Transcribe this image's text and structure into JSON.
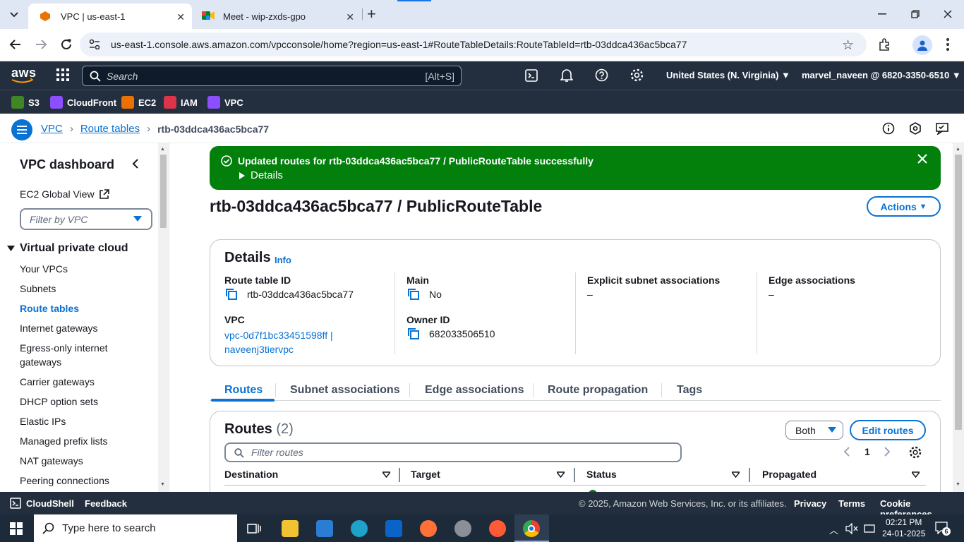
{
  "browser": {
    "tabs": [
      {
        "title": "VPC | us-east-1",
        "active": true
      },
      {
        "title": "Meet - wip-zxds-gpo",
        "active": false
      }
    ],
    "url": "us-east-1.console.aws.amazon.com/vpcconsole/home?region=us-east-1#RouteTableDetails:RouteTableId=rtb-03ddca436ac5bca77"
  },
  "aws_header": {
    "logo": "aws",
    "search_placeholder": "Search",
    "search_shortcut": "[Alt+S]",
    "region": "United States (N. Virginia)",
    "account": "marvel_naveen @ 6820-3350-6510",
    "favorites": [
      {
        "label": "S3",
        "color": "#3f8624"
      },
      {
        "label": "CloudFront",
        "color": "#8c4fff"
      },
      {
        "label": "EC2",
        "color": "#ed7100"
      },
      {
        "label": "IAM",
        "color": "#dd344c"
      },
      {
        "label": "VPC",
        "color": "#8c4fff"
      }
    ]
  },
  "breadcrumb": {
    "items": [
      "VPC",
      "Route tables"
    ],
    "current": "rtb-03ddca436ac5bca77"
  },
  "sidebar": {
    "title": "VPC dashboard",
    "ec2_global_view": "EC2 Global View",
    "filter_placeholder": "Filter by VPC",
    "section": "Virtual private cloud",
    "items": [
      {
        "label": "Your VPCs"
      },
      {
        "label": "Subnets"
      },
      {
        "label": "Route tables",
        "active": true
      },
      {
        "label": "Internet gateways"
      },
      {
        "label": "Egress-only internet gateways"
      },
      {
        "label": "Carrier gateways"
      },
      {
        "label": "DHCP option sets"
      },
      {
        "label": "Elastic IPs"
      },
      {
        "label": "Managed prefix lists"
      },
      {
        "label": "NAT gateways"
      },
      {
        "label": "Peering connections"
      }
    ]
  },
  "flash": {
    "message": "Updated routes for rtb-03ddca436ac5bca77 / PublicRouteTable successfully",
    "details": "Details",
    "color": "#037f0c"
  },
  "page": {
    "title": "rtb-03ddca436ac5bca77 / PublicRouteTable",
    "actions": "Actions"
  },
  "details": {
    "heading": "Details",
    "info": "Info",
    "route_table_id_label": "Route table ID",
    "route_table_id": "rtb-03ddca436ac5bca77",
    "vpc_label": "VPC",
    "vpc_link_1": "vpc-0d7f1bc33451598ff |",
    "vpc_link_2": "naveenj3tiervpc",
    "main_label": "Main",
    "main_value": "No",
    "owner_label": "Owner ID",
    "owner_value": "682033506510",
    "explicit_label": "Explicit subnet associations",
    "explicit_value": "–",
    "edge_label": "Edge associations",
    "edge_value": "–"
  },
  "tabs": [
    "Routes",
    "Subnet associations",
    "Edge associations",
    "Route propagation",
    "Tags"
  ],
  "routes": {
    "heading": "Routes",
    "count": "(2)",
    "filter_select": "Both",
    "edit_button": "Edit routes",
    "filter_placeholder": "Filter routes",
    "page": "1",
    "columns": [
      "Destination",
      "Target",
      "Status",
      "Propagated"
    ]
  },
  "footer": {
    "cloudshell": "CloudShell",
    "feedback": "Feedback",
    "copyright": "© 2025, Amazon Web Services, Inc. or its affiliates.",
    "privacy": "Privacy",
    "terms": "Terms",
    "cookie": "Cookie preferences"
  },
  "taskbar": {
    "search_placeholder": "Type here to search",
    "time": "02:21 PM",
    "date": "24-01-2025",
    "notification_count": "6"
  }
}
